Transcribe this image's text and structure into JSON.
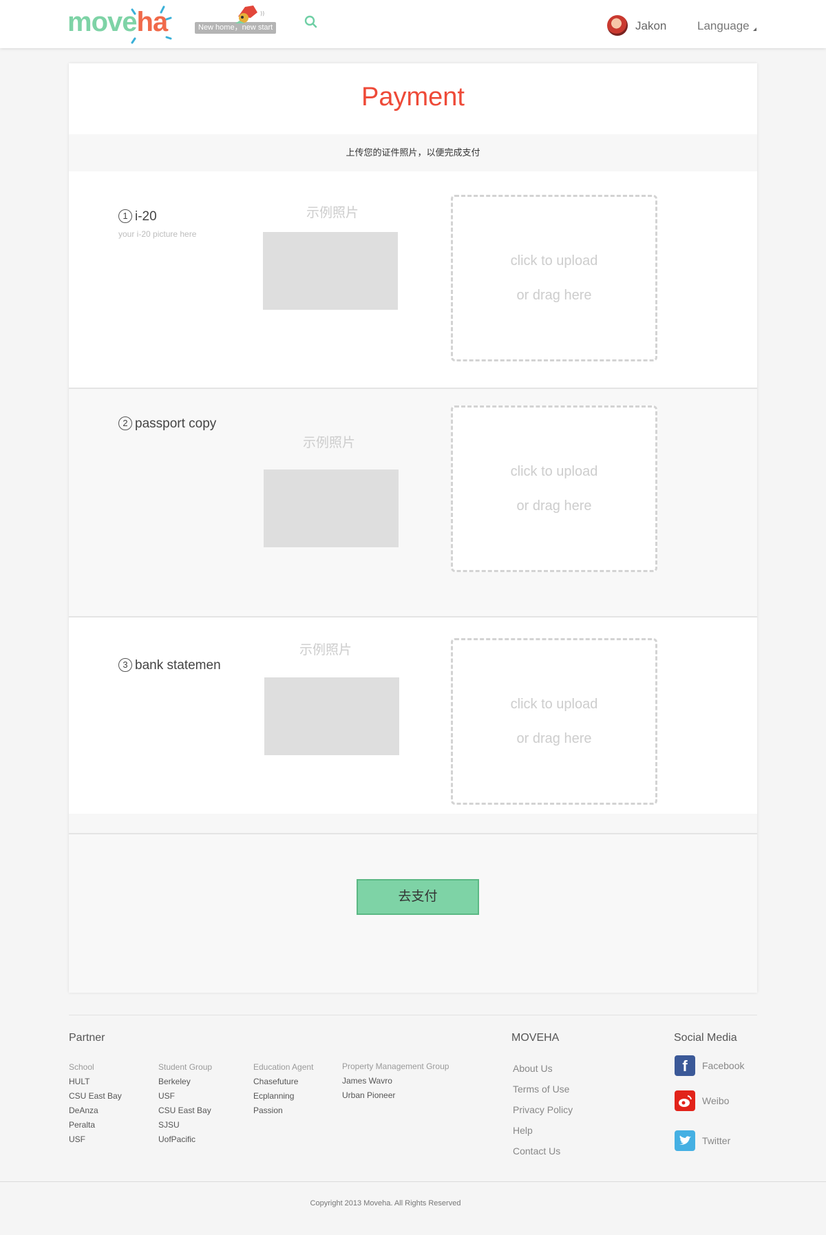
{
  "header": {
    "logo_left": "move",
    "logo_right": "ha",
    "slogan": "New home，new start",
    "username": "Jakon",
    "language_label": "Language"
  },
  "page": {
    "title": "Payment",
    "subtitle": "上传您的证件照片，以便完成支付"
  },
  "uploads": [
    {
      "num": "1",
      "label": "i-20",
      "hint": "your i-20 picture here",
      "example_label": "示例照片",
      "upload_line1": "click to upload",
      "upload_line2": "or drag here"
    },
    {
      "num": "2",
      "label": "passport copy",
      "hint": "",
      "example_label": "示例照片",
      "upload_line1": "click to upload",
      "upload_line2": "or drag here"
    },
    {
      "num": "3",
      "label": "bank statemen",
      "hint": "",
      "example_label": "示例照片",
      "upload_line1": "click to upload",
      "upload_line2": "or drag here"
    }
  ],
  "pay_button": "去支付",
  "footer": {
    "partner_heading": "Partner",
    "partner_columns": [
      {
        "heading": "School",
        "items": [
          "HULT",
          "CSU East Bay",
          "DeAnza",
          "Peralta",
          "USF"
        ]
      },
      {
        "heading": "Student Group",
        "items": [
          "Berkeley",
          "USF",
          "CSU East Bay",
          "SJSU",
          "UofPacific"
        ]
      },
      {
        "heading": "Education Agent",
        "items": [
          "Chasefuture",
          "Ecplanning",
          "Passion"
        ]
      },
      {
        "heading": "Property Management Group",
        "items": [
          "James Wavro",
          "Urban Pioneer"
        ]
      }
    ],
    "moveha_heading": "MOVEHA",
    "moveha_links": [
      "About Us",
      "Terms of Use",
      "Privacy Policy",
      "Help",
      "Contact Us"
    ],
    "social_heading": "Social Media",
    "social": [
      {
        "name": "Facebook",
        "icon": "facebook-icon",
        "color": "#3b5998"
      },
      {
        "name": "Weibo",
        "icon": "weibo-icon",
        "color": "#e2231a"
      },
      {
        "name": "Twitter",
        "icon": "twitter-icon",
        "color": "#45b0e3"
      }
    ],
    "copyright": "Copyright 2013 Moveha.  All Rights Reserved"
  },
  "colors": {
    "accent_green": "#7ed3a6",
    "accent_red": "#ee4a38",
    "upload_border": "#d3d3d3"
  }
}
